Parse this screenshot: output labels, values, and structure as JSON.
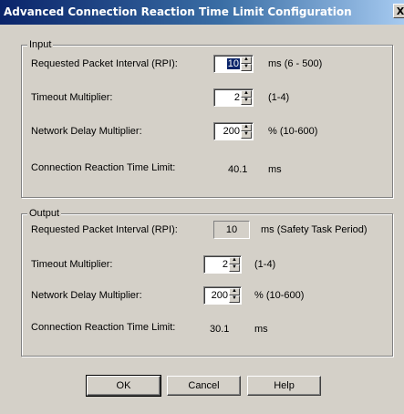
{
  "window": {
    "title": "Advanced Connection Reaction Time Limit Configuration",
    "close_glyph": "X"
  },
  "input": {
    "legend": "Input",
    "rpi": {
      "label": "Requested Packet Interval (RPI):",
      "value": "10",
      "range": "ms (6 - 500)"
    },
    "timeout": {
      "label": "Timeout Multiplier:",
      "value": "2",
      "range": "(1-4)"
    },
    "delay": {
      "label": "Network Delay Multiplier:",
      "value": "200",
      "range": "% (10-600)"
    },
    "limit": {
      "label": "Connection Reaction Time Limit:",
      "value": "40.1",
      "unit": "ms"
    }
  },
  "output": {
    "legend": "Output",
    "rpi": {
      "label": "Requested Packet Interval (RPI):",
      "value": "10",
      "range": "ms (Safety Task Period)"
    },
    "timeout": {
      "label": "Timeout Multiplier:",
      "value": "2",
      "range": "(1-4)"
    },
    "delay": {
      "label": "Network Delay Multiplier:",
      "value": "200",
      "range": "% (10-600)"
    },
    "limit": {
      "label": "Connection Reaction Time Limit:",
      "value": "30.1",
      "unit": "ms"
    }
  },
  "buttons": {
    "ok": "OK",
    "cancel": "Cancel",
    "help": "Help"
  },
  "icons": {
    "spin_up": "spin-up-arrow",
    "spin_down": "spin-down-arrow"
  }
}
